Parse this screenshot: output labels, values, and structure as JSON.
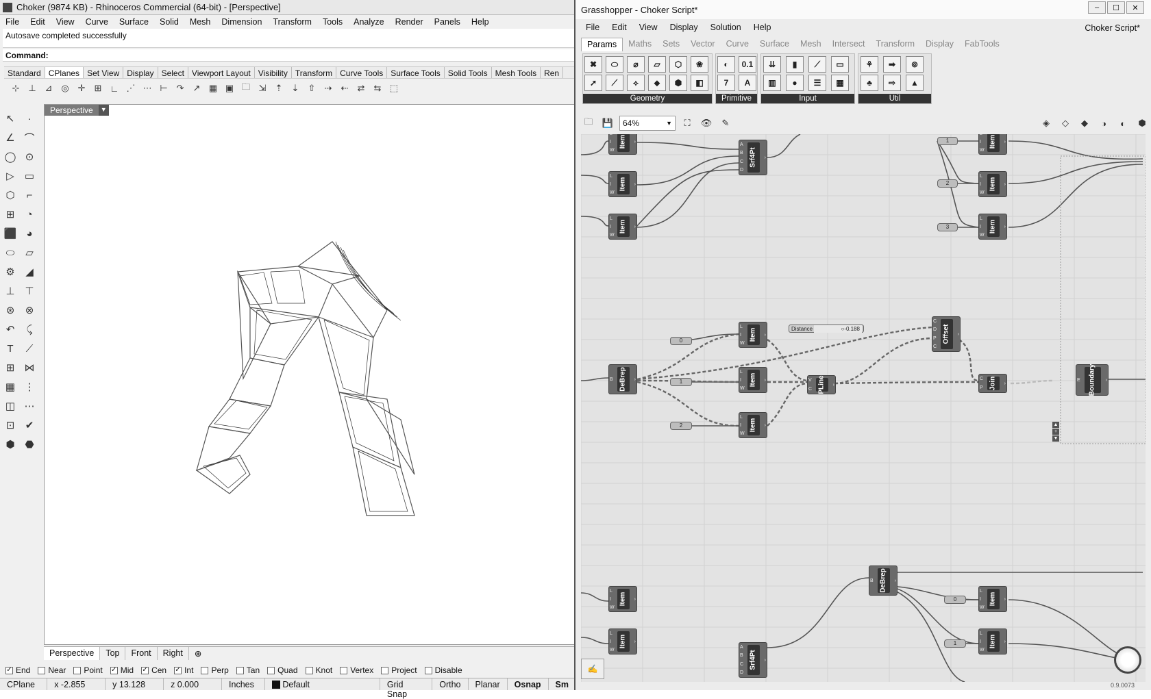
{
  "rhino": {
    "title": "Choker (9874 KB) - Rhinoceros Commercial (64-bit) - [Perspective]",
    "menu": [
      "File",
      "Edit",
      "View",
      "Curve",
      "Surface",
      "Solid",
      "Mesh",
      "Dimension",
      "Transform",
      "Tools",
      "Analyze",
      "Render",
      "Panels",
      "Help"
    ],
    "history": "Autosave completed successfully",
    "command_label": "Command:",
    "toolbar_tabs": [
      "Standard",
      "CPlanes",
      "Set View",
      "Display",
      "Select",
      "Viewport Layout",
      "Visibility",
      "Transform",
      "Curve Tools",
      "Surface Tools",
      "Solid Tools",
      "Mesh Tools",
      "Ren"
    ],
    "viewport_label": "Perspective",
    "viewport_tabs": [
      "Perspective",
      "Top",
      "Front",
      "Right"
    ],
    "viewport_add": "⊕",
    "osnaps": [
      {
        "label": "End",
        "checked": true
      },
      {
        "label": "Near",
        "checked": false
      },
      {
        "label": "Point",
        "checked": false
      },
      {
        "label": "Mid",
        "checked": true
      },
      {
        "label": "Cen",
        "checked": true
      },
      {
        "label": "Int",
        "checked": true
      },
      {
        "label": "Perp",
        "checked": false
      },
      {
        "label": "Tan",
        "checked": false
      },
      {
        "label": "Quad",
        "checked": false
      },
      {
        "label": "Knot",
        "checked": false
      },
      {
        "label": "Vertex",
        "checked": false
      },
      {
        "label": "Project",
        "checked": false
      },
      {
        "label": "Disable",
        "checked": false
      }
    ],
    "status": {
      "cplane": "CPlane",
      "x": "x -2.855",
      "y": "y 13.128",
      "z": "z 0.000",
      "units": "Inches",
      "layer": "Default",
      "grid": "Grid Snap",
      "ortho": "Ortho",
      "planar": "Planar",
      "osnap": "Osnap",
      "smart": "Sm"
    }
  },
  "gh": {
    "title": "Grasshopper - Choker Script*",
    "menu": [
      "File",
      "Edit",
      "View",
      "Display",
      "Solution",
      "Help"
    ],
    "doc_name": "Choker Script*",
    "tabs": [
      "Params",
      "Maths",
      "Sets",
      "Vector",
      "Curve",
      "Surface",
      "Mesh",
      "Intersect",
      "Transform",
      "Display",
      "FabTools"
    ],
    "groups": [
      "Geometry",
      "Primitive",
      "Input",
      "Util"
    ],
    "primitive_labels": [
      "0.1",
      "7",
      "A"
    ],
    "zoom": "64%",
    "version": "0.9.0073",
    "components": [
      {
        "label": "Item"
      },
      {
        "label": "Srf4Pt"
      },
      {
        "label": "DeBrep"
      },
      {
        "label": "PLine"
      },
      {
        "label": "Offset"
      },
      {
        "label": "Join"
      },
      {
        "label": "Boundary"
      }
    ],
    "slider": {
      "label": "Distance",
      "value": "-0.188"
    },
    "numbers": [
      "0",
      "1",
      "2",
      "3"
    ]
  }
}
